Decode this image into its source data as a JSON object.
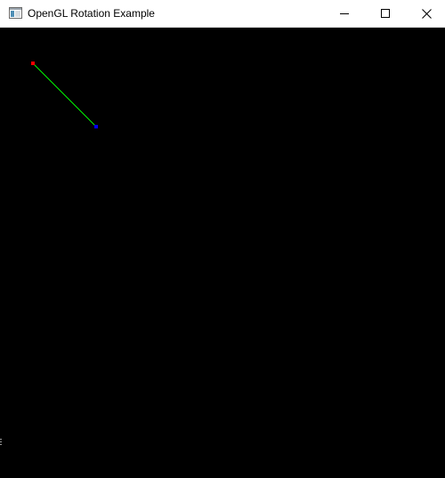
{
  "window": {
    "title": "OpenGL Rotation Example",
    "icon": "app-window-icon",
    "controls": {
      "minimize_icon": "minimize-icon",
      "maximize_icon": "maximize-icon",
      "close_icon": "close-icon"
    }
  },
  "canvas": {
    "background": "#000000",
    "line": {
      "color": "#00ff00",
      "start_point_color": "#ff0000",
      "end_point_color": "#0000ff"
    }
  }
}
